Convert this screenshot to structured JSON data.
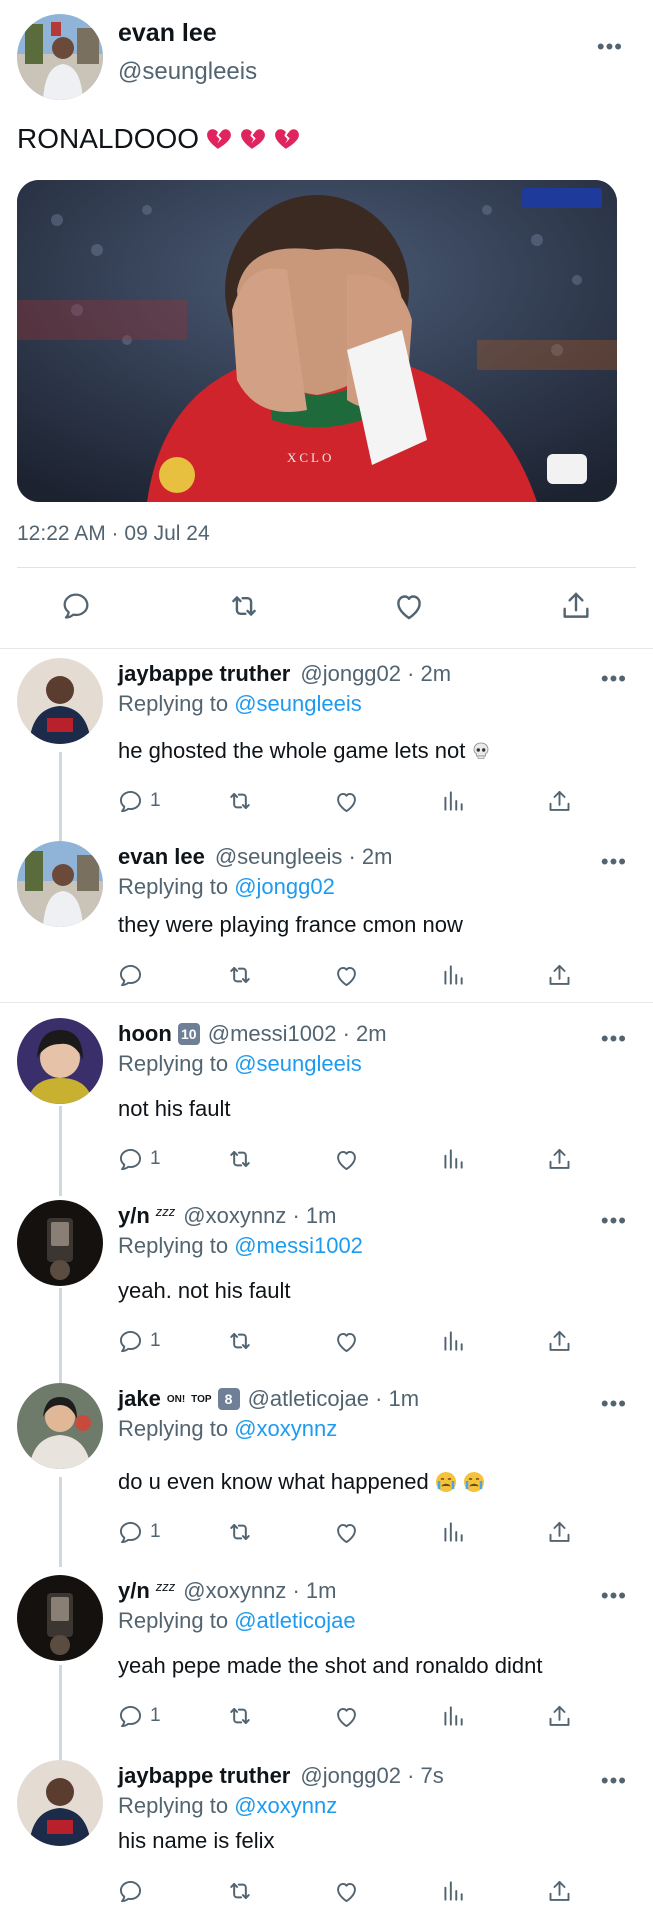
{
  "main_tweet": {
    "name": "evan lee",
    "handle": "@seungleeis",
    "text": "RONALDOOO",
    "emojis": [
      "broken-heart",
      "broken-heart",
      "broken-heart"
    ],
    "timestamp": "12:22 AM · 09 Jul 24",
    "media_overlay_text": "XCLO"
  },
  "replies": [
    {
      "name": "jaybappe truther",
      "handle_time": "@jongg02 · 2m",
      "replying_prefix": "Replying to ",
      "replying_to": "@seungleeis",
      "text": "he ghosted the whole game lets not",
      "reply_count": "1",
      "avatar": "jersey"
    },
    {
      "name": "evan lee",
      "handle_time": "@seungleeis · 2m",
      "replying_prefix": "Replying to ",
      "replying_to": "@jongg02",
      "text": "they were playing france cmon now",
      "reply_count": "",
      "avatar": "street"
    },
    {
      "name": "hoon",
      "badge": "10",
      "handle_time": "@messi1002 · 2m",
      "replying_prefix": "Replying to ",
      "replying_to": "@seungleeis",
      "text": "not his fault",
      "reply_count": "1",
      "avatar": "portrait"
    },
    {
      "name": "y/n",
      "extra": "zzz",
      "handle_time": "@xoxynnz · 1m",
      "replying_prefix": "Replying to ",
      "replying_to": "@messi1002",
      "text": "yeah. not his fault",
      "reply_count": "1",
      "avatar": "dark"
    },
    {
      "name": "jake",
      "extra_labels": [
        "ON!",
        "TOP"
      ],
      "badge": "8",
      "handle_time": "@atleticojae · 1m",
      "replying_prefix": "Replying to ",
      "replying_to": "@xoxynnz",
      "text": "do u even know what happened",
      "reply_count": "1",
      "avatar": "person"
    },
    {
      "name": "y/n",
      "extra": "zzz",
      "handle_time": "@xoxynnz · 1m",
      "replying_prefix": "Replying to ",
      "replying_to": "@atleticojae",
      "text": "yeah pepe made the shot and ronaldo didnt",
      "reply_count": "1",
      "avatar": "dark"
    },
    {
      "name": "jaybappe truther",
      "handle_time": "@jongg02 · 7s",
      "replying_prefix": "Replying to ",
      "replying_to": "@xoxynnz",
      "text": "his name is felix",
      "reply_count": "",
      "avatar": "jersey"
    }
  ],
  "icons": {
    "reply": "reply-icon",
    "retweet": "retweet-icon",
    "like": "like-icon",
    "views": "views-icon",
    "share": "share-icon",
    "more": "more-icon"
  },
  "colors": {
    "primary_text": "#0f1419",
    "secondary_text": "#536471",
    "link": "#1d9bf0",
    "divider": "#e6e9eb"
  }
}
